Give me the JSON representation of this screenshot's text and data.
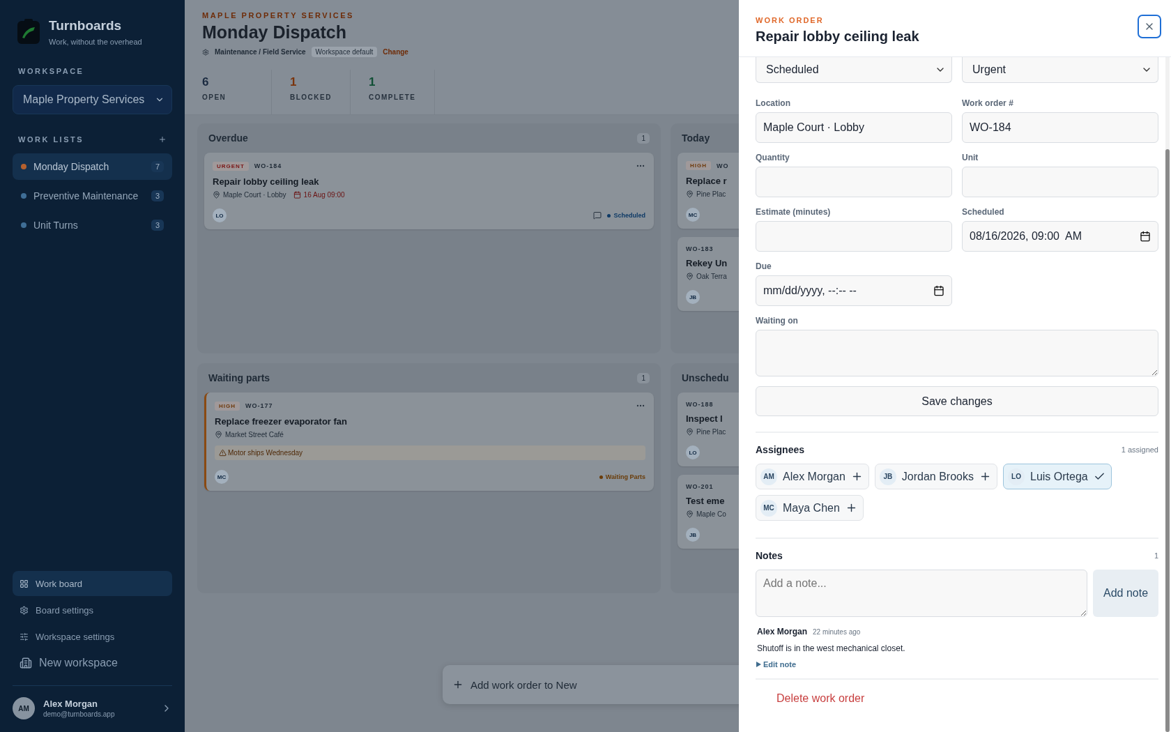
{
  "sidebar": {
    "brand": "Turnboards",
    "tagline": "Work, without the overhead",
    "workspace_label": "WORKSPACE",
    "workspace": "Maple Property Services",
    "work_lists_label": "WORK LISTS",
    "work_lists": [
      {
        "name": "Monday Dispatch",
        "count": "7",
        "selected": true,
        "color": "#b4602e"
      },
      {
        "name": "Preventive Maintenance",
        "count": "3",
        "selected": false,
        "color": "#3f6e96"
      },
      {
        "name": "Unit Turns",
        "count": "3",
        "selected": false,
        "color": "#3f6e96"
      }
    ],
    "nav": [
      {
        "kind": "board",
        "label": "Work board",
        "selected": true
      },
      {
        "kind": "settings",
        "label": "Board settings",
        "selected": false
      },
      {
        "kind": "workspace",
        "label": "Workspace settings",
        "selected": false
      },
      {
        "kind": "new",
        "label": "New workspace",
        "selected": false
      }
    ],
    "user": {
      "initials": "AM",
      "name": "Alex Morgan",
      "email": "demo@turnboards.app"
    }
  },
  "header": {
    "org": "MAPLE PROPERTY SERVICES",
    "title": "Monday Dispatch",
    "template": "Maintenance / Field Service",
    "template_badge": "Workspace default",
    "change_link": "Change"
  },
  "stats": [
    {
      "value": "6",
      "label": "OPEN",
      "color": "#1a2a40"
    },
    {
      "value": "1",
      "label": "BLOCKED",
      "color": "#7a340c"
    },
    {
      "value": "1",
      "label": "COMPLETE",
      "color": "#0f4e34"
    }
  ],
  "board": {
    "columns": [
      {
        "title": "Overdue",
        "count": "1",
        "cards": [
          {
            "priority": {
              "label": "URGENT",
              "color": "#7a1515"
            },
            "number": "WO-184",
            "title": "Repair lobby ceiling leak",
            "location": "Maple Court · Lobby",
            "due": "16 Aug 09:00",
            "assignee": "LO",
            "has_comments": true,
            "status": {
              "label": "Scheduled",
              "color": "#0e3a66"
            },
            "flagged": false
          }
        ]
      },
      {
        "title": "Today",
        "cards": [
          {
            "priority": {
              "label": "HIGH",
              "color": "#6e3a0c"
            },
            "number": "WO",
            "title": "Replace r",
            "location": "Pine Plac",
            "assignee": "MC",
            "has_comments": false,
            "flagged": false
          },
          {
            "number": "WO-183",
            "title": "Rekey Un",
            "location": "Oak Terra",
            "assignee": "JB",
            "has_comments": false,
            "flagged": false
          }
        ]
      },
      {
        "title": "Waiting parts",
        "count": "1",
        "cards": [
          {
            "priority": {
              "label": "HIGH",
              "color": "#6e3a0c"
            },
            "number": "WO-177",
            "title": "Replace freezer evaporator fan",
            "location": "Market Street Café",
            "warning": "Motor ships Wednesday",
            "assignee": "MC",
            "has_comments": false,
            "status": {
              "label": "Waiting Parts",
              "color": "#6a3c08"
            },
            "flagged": true
          }
        ]
      },
      {
        "title": "Unschedu",
        "cards": [
          {
            "number": "WO-188",
            "title": "Inspect l",
            "location": "Pine Plac",
            "assignee": "LO",
            "has_comments": false,
            "flagged": false
          },
          {
            "number": "WO-201",
            "title": "Test eme",
            "location": "Maple Co",
            "assignee": "JB",
            "has_comments": false,
            "flagged": false
          }
        ]
      }
    ]
  },
  "add_bar": "Add work order to New",
  "drawer": {
    "eyebrow": "WORK ORDER",
    "title": "Repair lobby ceiling leak",
    "fields": [
      {
        "kind": "select",
        "value": "Scheduled"
      },
      {
        "kind": "select",
        "value": "Urgent"
      },
      {
        "kind": "text",
        "label": "Location",
        "value": "Maple Court · Lobby"
      },
      {
        "kind": "text",
        "label": "Work order #",
        "value": "WO-184"
      },
      {
        "kind": "text",
        "label": "Quantity"
      },
      {
        "kind": "text",
        "label": "Unit"
      },
      {
        "kind": "text",
        "label": "Estimate (minutes)"
      },
      {
        "kind": "date",
        "label": "Scheduled",
        "value": "08/16/2026, 09:00  AM"
      },
      {
        "kind": "date",
        "label": "Due",
        "value": "mm/dd/yyyy, --:-- --"
      },
      {
        "kind": "textarea",
        "label": "Waiting on"
      }
    ],
    "save": "Save changes",
    "assignees": {
      "title": "Assignees",
      "summary": "1 assigned",
      "people": [
        {
          "initials": "AM",
          "name": "Alex Morgan",
          "selected": false
        },
        {
          "initials": "JB",
          "name": "Jordan Brooks",
          "selected": false
        },
        {
          "initials": "LO",
          "name": "Luis Ortega",
          "selected": true
        },
        {
          "initials": "MC",
          "name": "Maya Chen",
          "selected": false
        }
      ]
    },
    "notes": {
      "title": "Notes",
      "count": "1",
      "placeholder": "Add a note...",
      "button": "Add note",
      "items": [
        {
          "author": "Alex Morgan",
          "time": "22 minutes ago",
          "text": "Shutoff is in the west mechanical closet.",
          "edit": "Edit note"
        }
      ]
    },
    "delete": "Delete work order"
  }
}
